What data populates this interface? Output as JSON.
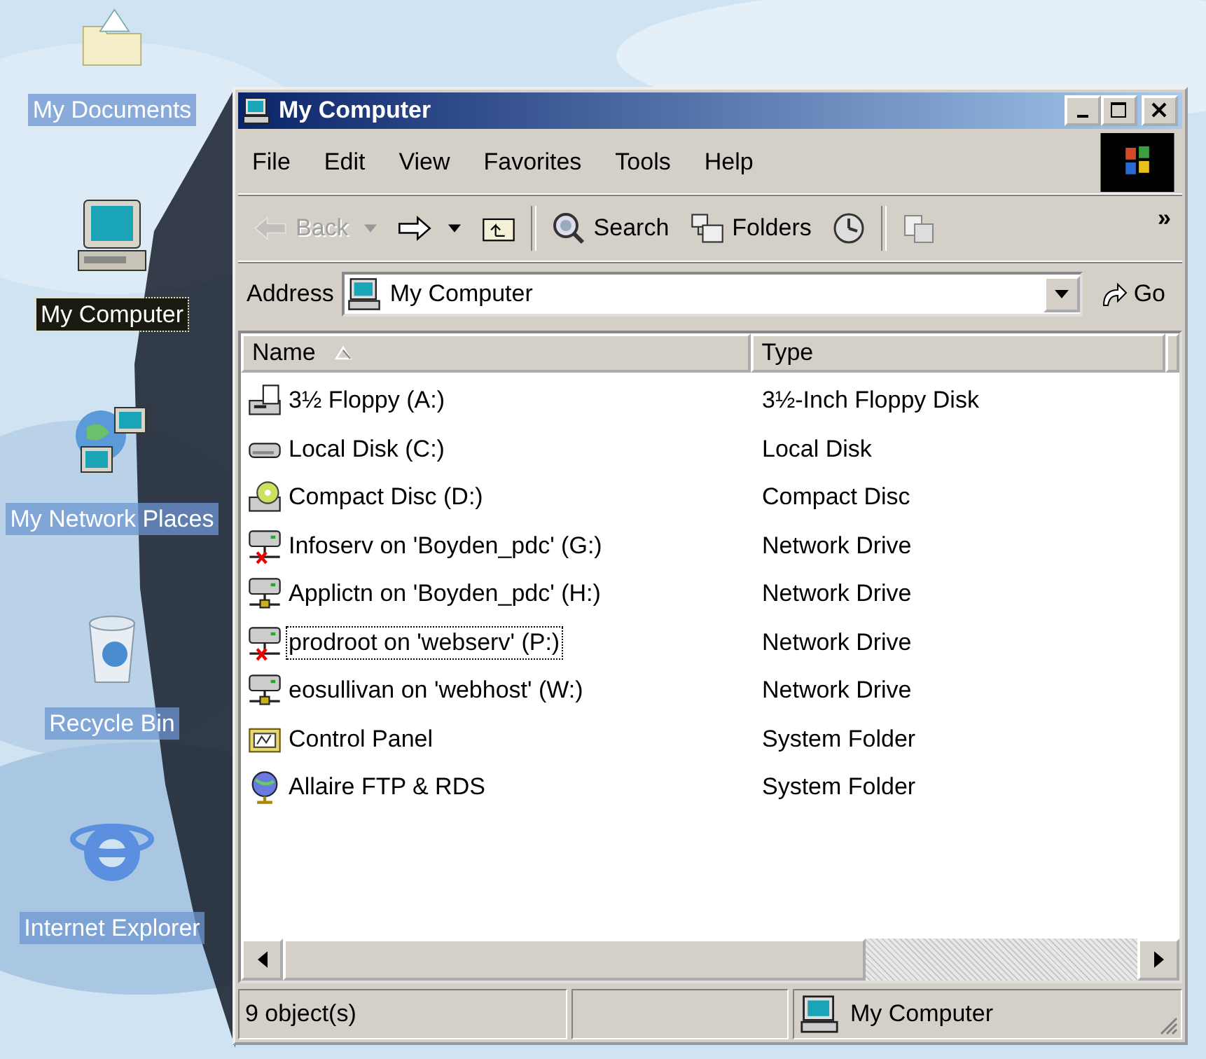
{
  "desktop_icons": [
    {
      "label": "My Documents",
      "kind": "documents",
      "selected": false
    },
    {
      "label": "My Computer",
      "kind": "computer",
      "selected": true
    },
    {
      "label": "My Network Places",
      "kind": "network",
      "selected": false
    },
    {
      "label": "Recycle Bin",
      "kind": "recycle",
      "selected": false
    },
    {
      "label": "Internet Explorer",
      "kind": "browser",
      "selected": false
    }
  ],
  "window": {
    "title": "My Computer"
  },
  "menu": [
    "File",
    "Edit",
    "View",
    "Favorites",
    "Tools",
    "Help"
  ],
  "toolbar": [
    {
      "kind": "back",
      "label": "Back",
      "disabled": true
    },
    {
      "kind": "forward",
      "disabled": false
    },
    {
      "kind": "up",
      "disabled": false
    },
    {
      "kind": "separator"
    },
    {
      "kind": "search",
      "label": "Search",
      "disabled": false
    },
    {
      "kind": "folders",
      "label": "Folders",
      "disabled": false
    },
    {
      "kind": "history",
      "disabled": false
    },
    {
      "kind": "separator"
    },
    {
      "kind": "moveto",
      "disabled": false
    }
  ],
  "toolbar_more": "»",
  "address": {
    "label": "Address",
    "value": "My Computer",
    "go": "Go"
  },
  "table": {
    "columns": [
      {
        "label": "Name",
        "sorted": true
      },
      {
        "label": "Type",
        "sorted": false
      }
    ],
    "rows": [
      {
        "name": "3½ Floppy (A:)",
        "type": "3½-Inch Floppy Disk",
        "kind": "floppy",
        "focused": false
      },
      {
        "name": "Local Disk (C:)",
        "type": "Local Disk",
        "kind": "disk",
        "focused": false
      },
      {
        "name": "Compact Disc (D:)",
        "type": "Compact Disc",
        "kind": "cd",
        "focused": false
      },
      {
        "name": "Infoserv on 'Boyden_pdc' (G:)",
        "type": "Network Drive",
        "kind": "netdrive",
        "disconnected": true,
        "focused": false
      },
      {
        "name": "Applictn on 'Boyden_pdc' (H:)",
        "type": "Network Drive",
        "kind": "netdrive",
        "disconnected": false,
        "focused": false
      },
      {
        "name": "prodroot on 'webserv' (P:)",
        "type": "Network Drive",
        "kind": "netdrive",
        "disconnected": true,
        "focused": true
      },
      {
        "name": "eosullivan on 'webhost' (W:)",
        "type": "Network Drive",
        "kind": "netdrive",
        "disconnected": false,
        "focused": false
      },
      {
        "name": "Control Panel",
        "type": "System Folder",
        "kind": "controlpanel",
        "focused": false
      },
      {
        "name": "Allaire FTP & RDS",
        "type": "System Folder",
        "kind": "globe",
        "focused": false
      }
    ]
  },
  "status_bar": {
    "objects": "9 object(s)",
    "location": "My Computer"
  }
}
